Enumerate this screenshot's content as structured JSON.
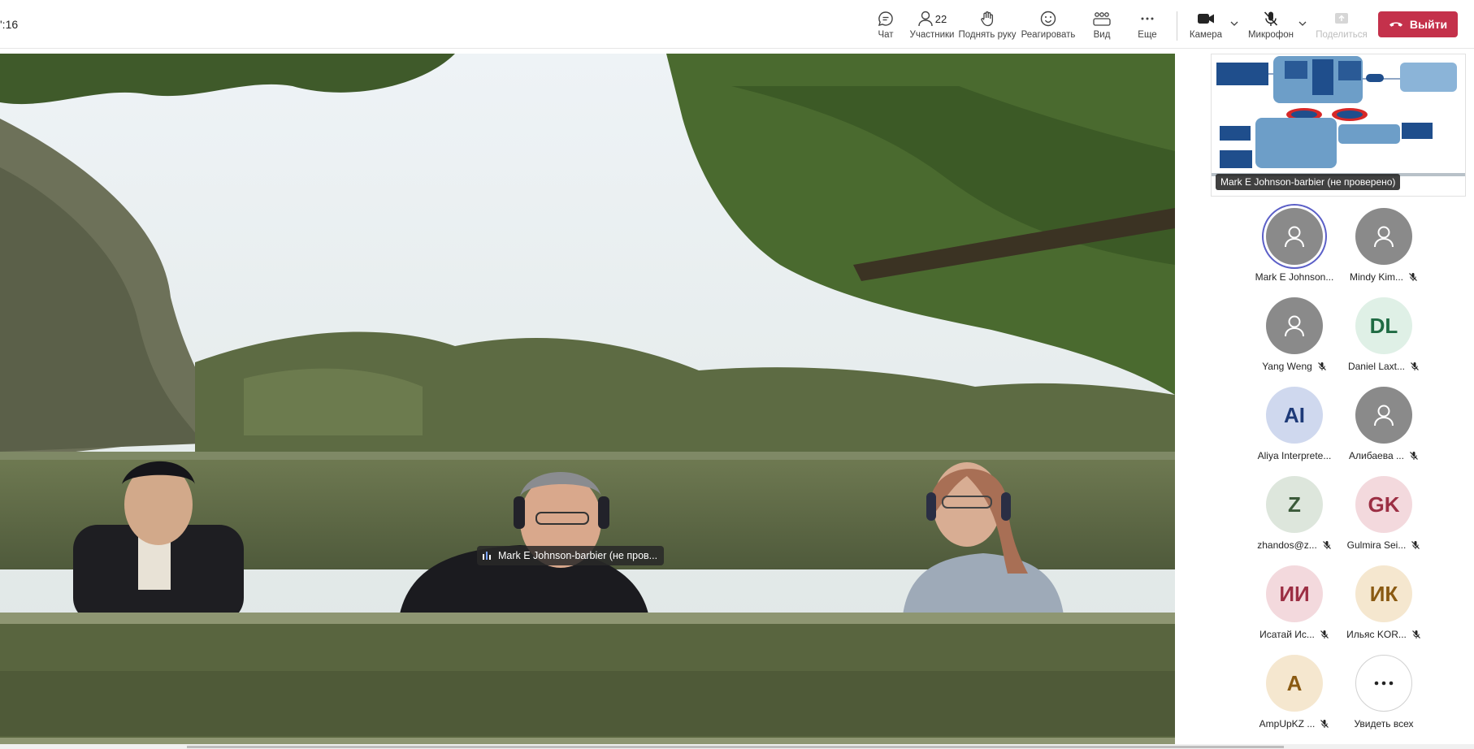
{
  "header": {
    "timer": "':16",
    "chat_label": "Чат",
    "participants_label": "Участники",
    "participants_count": "22",
    "raise_hand_label": "Поднять руку",
    "react_label": "Реагировать",
    "view_label": "Вид",
    "more_label": "Еще",
    "camera_label": "Камера",
    "mic_label": "Микрофон",
    "share_label": "Поделиться",
    "leave_label": "Выйти"
  },
  "stage": {
    "speaker_name": "Mark E Johnson-barbier (не пров..."
  },
  "shared_content": {
    "presenter_label": "Mark E Johnson-barbier (не проверено)"
  },
  "participants": [
    {
      "initials": "",
      "name": "Mark E Johnson...",
      "muted": false,
      "speaking": true,
      "bg": "#8a8a8a",
      "fg": "#ffffff",
      "icon": "person-icon"
    },
    {
      "initials": "",
      "name": "Mindy Kim...",
      "muted": true,
      "speaking": false,
      "bg": "#8a8a8a",
      "fg": "#ffffff",
      "icon": "person-icon"
    },
    {
      "initials": "",
      "name": "Yang Weng",
      "muted": true,
      "speaking": false,
      "bg": "#8a8a8a",
      "fg": "#ffffff",
      "icon": "person-icon"
    },
    {
      "initials": "DL",
      "name": "Daniel Laxt...",
      "muted": true,
      "speaking": false,
      "bg": "#dff0e6",
      "fg": "#1f6b43"
    },
    {
      "initials": "AI",
      "name": "Aliya Interprete...",
      "muted": false,
      "speaking": false,
      "bg": "#cfd8ee",
      "fg": "#1e3a78"
    },
    {
      "initials": "",
      "name": "Алибаева ...",
      "muted": true,
      "speaking": false,
      "bg": "#8a8a8a",
      "fg": "#ffffff",
      "icon": "person-icon"
    },
    {
      "initials": "Z",
      "name": "zhandos@z...",
      "muted": true,
      "speaking": false,
      "bg": "#dde6dc",
      "fg": "#3b5a3a"
    },
    {
      "initials": "GK",
      "name": "Gulmira Sei...",
      "muted": true,
      "speaking": false,
      "bg": "#f3d9dd",
      "fg": "#9c2f44"
    },
    {
      "initials": "ИИ",
      "name": "Исатай Ис...",
      "muted": true,
      "speaking": false,
      "bg": "#f3d9dd",
      "fg": "#9c2f44"
    },
    {
      "initials": "ИК",
      "name": "Ильяс KOR...",
      "muted": true,
      "speaking": false,
      "bg": "#f5e7cf",
      "fg": "#8a5a12"
    },
    {
      "initials": "A",
      "name": "AmpUpKZ ...",
      "muted": true,
      "speaking": false,
      "bg": "#f5e7cf",
      "fg": "#8a5a12"
    }
  ],
  "see_all": {
    "label": "Увидеть всех",
    "icon": "more-dots-icon"
  },
  "colors": {
    "leave": "#c4314b",
    "speaking_ring": "#5b5fc7"
  }
}
